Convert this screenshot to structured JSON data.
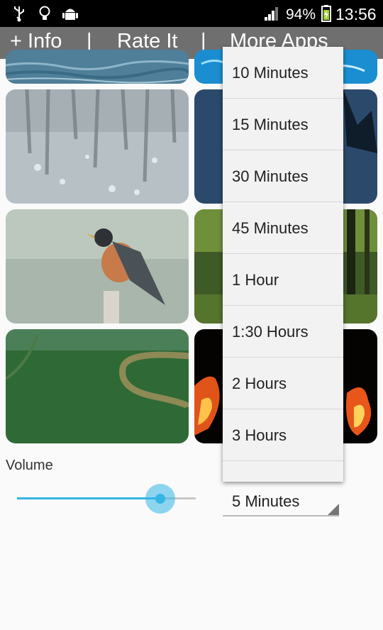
{
  "status_bar": {
    "icons": [
      "usb-icon",
      "lightbulb-icon",
      "android-icon",
      "signal-icon",
      "battery-charging-icon"
    ],
    "battery_percent": "94%",
    "time": "13:56"
  },
  "top_menu": {
    "info_label": "+ Info",
    "separator": "|",
    "rate_label": "Rate It",
    "more_apps_label": "More Apps"
  },
  "tiles": [
    {
      "scene": "water-ripples"
    },
    {
      "scene": "pool-water"
    },
    {
      "scene": "rain-on-glass"
    },
    {
      "scene": "night-tree"
    },
    {
      "scene": "robin-bird"
    },
    {
      "scene": "forest"
    },
    {
      "scene": "river-rainforest"
    },
    {
      "scene": "fire"
    }
  ],
  "volume": {
    "label": "Volume",
    "level": 0.8
  },
  "timer": {
    "selected": "5 Minutes",
    "options": [
      "10 Minutes",
      "15 Minutes",
      "30 Minutes",
      "45 Minutes",
      "1 Hour",
      "1:30 Hours",
      "2 Hours",
      "3 Hours"
    ]
  },
  "colors": {
    "accent": "#33b5e5",
    "menu_bar": "#6f6f6f",
    "status_bar": "#000000"
  }
}
